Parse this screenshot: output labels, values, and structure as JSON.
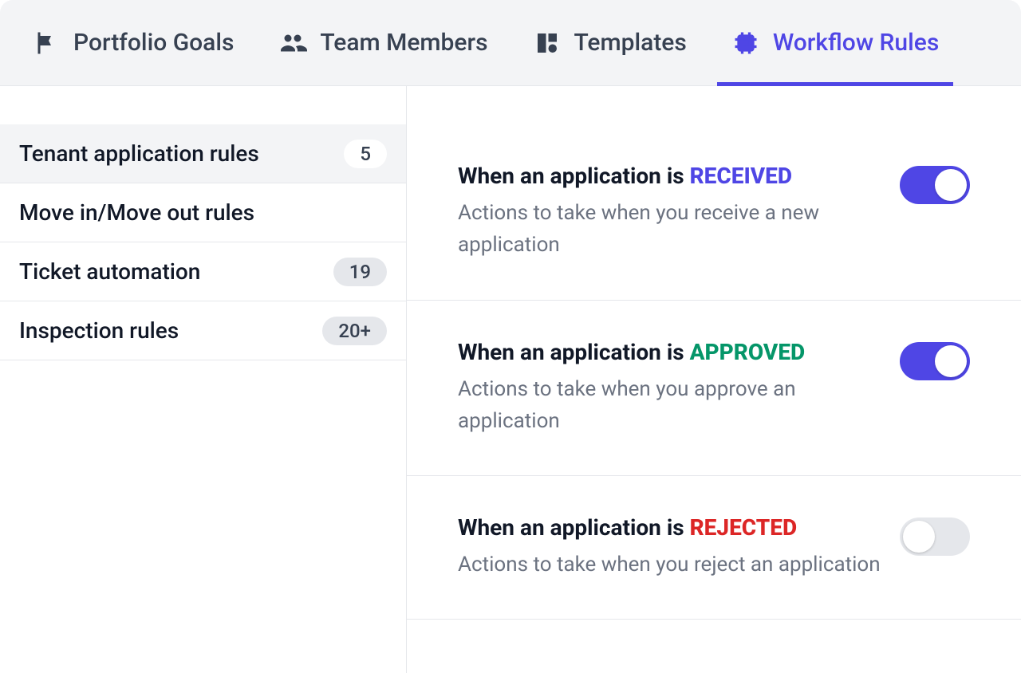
{
  "tabs": [
    {
      "label": "Portfolio Goals",
      "icon": "flag-icon",
      "active": false
    },
    {
      "label": "Team Members",
      "icon": "users-icon",
      "active": false
    },
    {
      "label": "Templates",
      "icon": "shapes-icon",
      "active": false
    },
    {
      "label": "Workflow Rules",
      "icon": "cpu-icon",
      "active": true
    }
  ],
  "sidebar": {
    "items": [
      {
        "label": "Tenant application rules",
        "count": "5",
        "active": true
      },
      {
        "label": "Move in/Move out rules",
        "count": "",
        "active": false
      },
      {
        "label": "Ticket automation",
        "count": "19",
        "active": false
      },
      {
        "label": "Inspection rules",
        "count": "20+",
        "active": false
      }
    ]
  },
  "rules": [
    {
      "prefix": "When an application is ",
      "status_label": "RECEIVED",
      "status_class": "status-received",
      "description": "Actions to take when you receive a new application",
      "enabled": true
    },
    {
      "prefix": "When an application is ",
      "status_label": "APPROVED",
      "status_class": "status-approved",
      "description": "Actions to take when you approve an application",
      "enabled": true
    },
    {
      "prefix": "When an application is ",
      "status_label": "REJECTED",
      "status_class": "status-rejected",
      "description": "Actions to take when you reject an application",
      "enabled": false
    }
  ]
}
